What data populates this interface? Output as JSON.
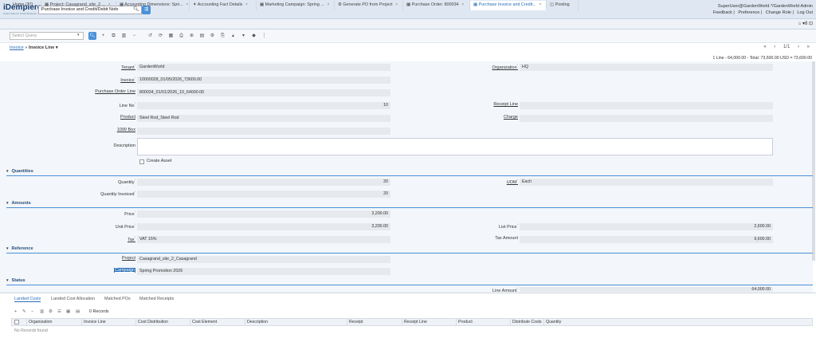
{
  "header": {
    "logo": "iDempiere",
    "logo_sub": "Smart Suite for Smart Business",
    "search_value": "Purchase Invoice and Credit/Debit Note",
    "user": "SuperUser@GardenWorld.*/GardenWorld Admin",
    "links": [
      "Feedback",
      "Preference",
      "Change Role",
      "Log Out"
    ]
  },
  "tabs": [
    {
      "label": "Home (27)"
    },
    {
      "label": "Project: Casagrand_site_2 ..."
    },
    {
      "label": "Accounting Dimensions: Spri..."
    },
    {
      "label": "Accounting Fact Details"
    },
    {
      "label": "Marketing Campaign: Spring ..."
    },
    {
      "label": "Generate PO from Project"
    },
    {
      "label": "Purchase Order: 800034"
    },
    {
      "label": "Purchase Invoice and Credit..."
    },
    {
      "label": "Posting"
    }
  ],
  "tab_right": "⌂  ▾8  ⊡",
  "toolbar": {
    "query_placeholder": "Select Query"
  },
  "breadcrumb": {
    "parent": "Invoice",
    "current": "Invoice Line ▾"
  },
  "nav": {
    "page": "1/1"
  },
  "summary": "1 Line - 64,000.00 - Total: 73,600.00 USD = 73,600.00",
  "form": {
    "tenant_label": "Tenant",
    "tenant": "GardenWorld",
    "org_label": "Organization",
    "org": "HQ",
    "invoice_label": "Invoice",
    "invoice": "10000028_01/05/2026_73600.00",
    "pol_label": "Purchase Order Line",
    "pol": "800034_01/01/2026_10_64000.00",
    "line_no_label": "Line No",
    "line_no": "10",
    "receipt_line_label": "Receipt Line",
    "receipt_line": "",
    "product_label": "Product",
    "product": "Steel Rod_Steel Rod",
    "charge_label": "Charge",
    "charge": "",
    "box_label": "1099 Box",
    "box": "",
    "desc_label": "Description",
    "desc": "",
    "create_asset": "Create Asset",
    "sec_quantities": "Quantities",
    "quantity_label": "Quantity",
    "quantity": "20",
    "uom_label": "UOM",
    "uom": "Each",
    "qty_inv_label": "Quantity Invoiced",
    "qty_inv": "20",
    "sec_amounts": "Amounts",
    "price_label": "Price",
    "price": "3,200.00",
    "unit_price_label": "Unit Price",
    "unit_price": "3,200.00",
    "list_price_label": "List Price",
    "list_price": "2,600.00",
    "tax_label": "Tax",
    "tax": "VAT 15%",
    "tax_amt_label": "Tax Amount",
    "tax_amt": "9,600.00",
    "sec_reference": "Reference",
    "project_label": "Project",
    "project": "Casagrand_site_2_Casagrand",
    "campaign_label": "Campaign",
    "campaign": "Spring Promotion 2026",
    "sec_status": "Status",
    "line_amt_label": "Line Amount",
    "line_amt": "64,000.00"
  },
  "bottom": {
    "tabs": [
      "Landed Costs",
      "Landed Cost Allocation",
      "Matched POs",
      "Matched Receipts"
    ],
    "records": "0 Records",
    "columns": [
      "Organization",
      "Invoice Line",
      "Cost Distribution",
      "Cost Element",
      "Description",
      "Receipt",
      "Receipt Line",
      "Product",
      "Distribute Costs",
      "Quantity"
    ],
    "no_records": "No Records found"
  },
  "colors": {
    "accent": "#4a90d9",
    "section": "#2a4d7a",
    "field": "#e6e9ed"
  }
}
